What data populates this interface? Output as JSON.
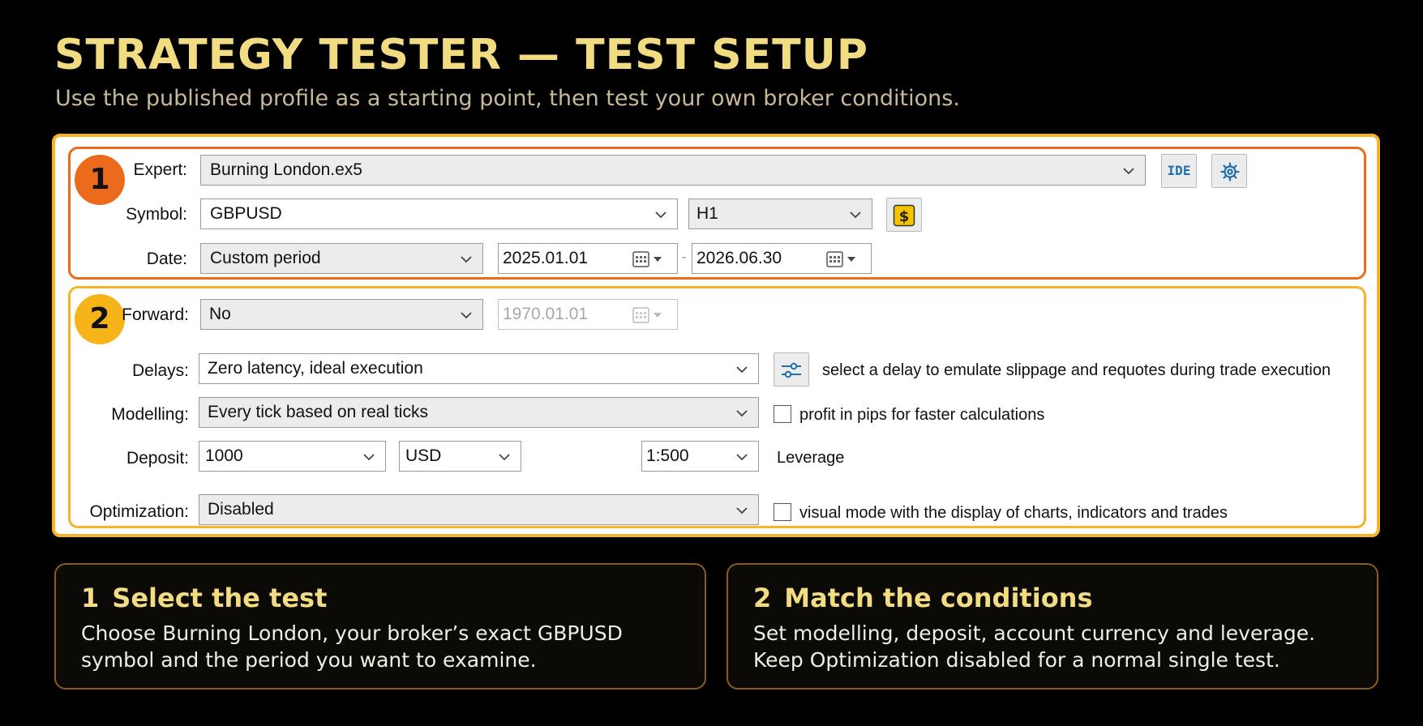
{
  "page": {
    "title": "STRATEGY TESTER — TEST SETUP",
    "subtitle": "Use the published profile as a starting point, then test your own broker conditions."
  },
  "section1": {
    "badge": "1",
    "expert_label": "Expert:",
    "expert_value": "Burning London.ex5",
    "ide_label": "IDE",
    "symbol_label": "Symbol:",
    "symbol_value": "GBPUSD",
    "timeframe_value": "H1",
    "date_label": "Date:",
    "date_mode": "Custom period",
    "date_from": "2025.01.01",
    "date_separator": "-",
    "date_to": "2026.06.30"
  },
  "section2": {
    "badge": "2",
    "forward_label": "Forward:",
    "forward_value": "No",
    "forward_date": "1970.01.01",
    "delays_label": "Delays:",
    "delays_value": "Zero latency, ideal execution",
    "delays_hint": "select a delay to emulate slippage and requotes during trade execution",
    "modelling_label": "Modelling:",
    "modelling_value": "Every tick based on real ticks",
    "pips_checkbox_label": "profit in pips for faster calculations",
    "pips_checked": false,
    "deposit_label": "Deposit:",
    "deposit_value": "1000",
    "currency_value": "USD",
    "leverage_value": "1:500",
    "leverage_label": "Leverage",
    "optimization_label": "Optimization:",
    "optimization_value": "Disabled",
    "visual_checkbox_label": "visual mode with the display of charts, indicators and trades",
    "visual_checked": false
  },
  "cards": [
    {
      "number": "1",
      "title": "Select the test",
      "body": "Choose Burning London, your broker’s exact GBPUSD symbol and the period you want to examine."
    },
    {
      "number": "2",
      "title": "Match the conditions",
      "body": "Set modelling, deposit, account currency and leverage. Keep Optimization disabled for a normal single test."
    }
  ],
  "colors": {
    "background": "#000000",
    "title": "#f2dc82",
    "section1_border": "#ec6a1c",
    "section2_border": "#f5b428",
    "card_border": "#8a5b1c",
    "icon_blue": "#1e6fb0",
    "dollar_button": "#f5c400"
  },
  "icons": {
    "ide": "ide-icon",
    "settings": "gear-icon",
    "symbol_properties": "dollar-icon",
    "calendar": "calendar-icon",
    "delay_settings": "sliders-icon",
    "dropdown": "chevron-down-icon"
  }
}
